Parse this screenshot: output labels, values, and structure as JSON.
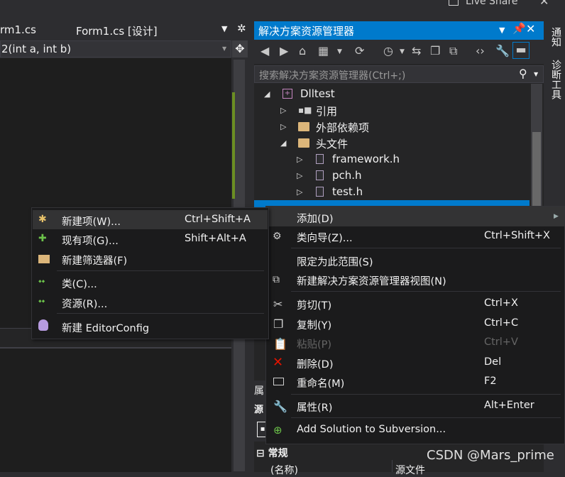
{
  "top": {
    "live_share": "Live Share",
    "close_glyph": "✕"
  },
  "editor": {
    "tab_file": "rm1.cs",
    "tab_design": "Form1.cs [设计]",
    "nav_signature": "2(int a, int b)"
  },
  "solution_explorer": {
    "title": "解决方案资源管理器",
    "search_placeholder": "搜索解决方案资源管理器(Ctrl+;)",
    "tree": [
      {
        "label": "Dlltest"
      },
      {
        "label": "引用"
      },
      {
        "label": "外部依赖项"
      },
      {
        "label": "头文件"
      },
      {
        "label": "framework.h"
      },
      {
        "label": "pch.h"
      },
      {
        "label": "test.h"
      }
    ]
  },
  "right_tabs": {
    "notifications": "通知",
    "diagnostics": "诊断工具"
  },
  "properties": {
    "header": "属",
    "row2": "源",
    "category": "常规",
    "name_label": "(名称)",
    "name_value": "源文件"
  },
  "context_menu": {
    "items": [
      {
        "label": "添加(D)",
        "shortcut": ""
      },
      {
        "label": "类向导(Z)...",
        "shortcut": "Ctrl+Shift+X"
      },
      {
        "label": "限定为此范围(S)",
        "shortcut": ""
      },
      {
        "label": "新建解决方案资源管理器视图(N)",
        "shortcut": ""
      },
      {
        "label": "剪切(T)",
        "shortcut": "Ctrl+X"
      },
      {
        "label": "复制(Y)",
        "shortcut": "Ctrl+C"
      },
      {
        "label": "粘贴(P)",
        "shortcut": "Ctrl+V"
      },
      {
        "label": "删除(D)",
        "shortcut": "Del"
      },
      {
        "label": "重命名(M)",
        "shortcut": "F2"
      },
      {
        "label": "属性(R)",
        "shortcut": "Alt+Enter"
      },
      {
        "label": "Add Solution to Subversion...",
        "shortcut": ""
      }
    ]
  },
  "add_submenu": {
    "items": [
      {
        "label": "新建项(W)...",
        "shortcut": "Ctrl+Shift+A"
      },
      {
        "label": "现有项(G)...",
        "shortcut": "Shift+Alt+A"
      },
      {
        "label": "新建筛选器(F)",
        "shortcut": ""
      },
      {
        "label": "类(C)...",
        "shortcut": ""
      },
      {
        "label": "资源(R)...",
        "shortcut": ""
      },
      {
        "label": "新建 EditorConfig",
        "shortcut": ""
      }
    ]
  },
  "watermark": "CSDN @Mars_prime",
  "colors": {
    "accent": "#007acc",
    "menu_bg": "#1b1b1c",
    "highlight": "#333334",
    "delete_red": "#e51400"
  }
}
